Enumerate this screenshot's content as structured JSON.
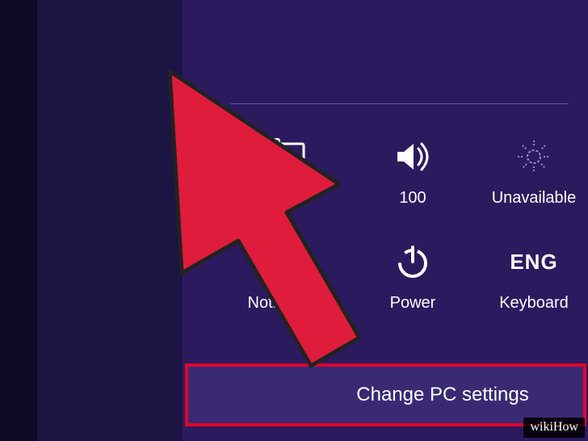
{
  "tiles": {
    "network": {
      "label": ""
    },
    "volume": {
      "label": "100"
    },
    "brightness": {
      "label": "Unavailable"
    },
    "notifications": {
      "label": "Notifications"
    },
    "power": {
      "label": "Power"
    },
    "keyboard": {
      "lang": "ENG",
      "label": "Keyboard"
    }
  },
  "change_settings": {
    "label": "Change PC settings"
  },
  "watermark": {
    "text": "wikiHow"
  }
}
